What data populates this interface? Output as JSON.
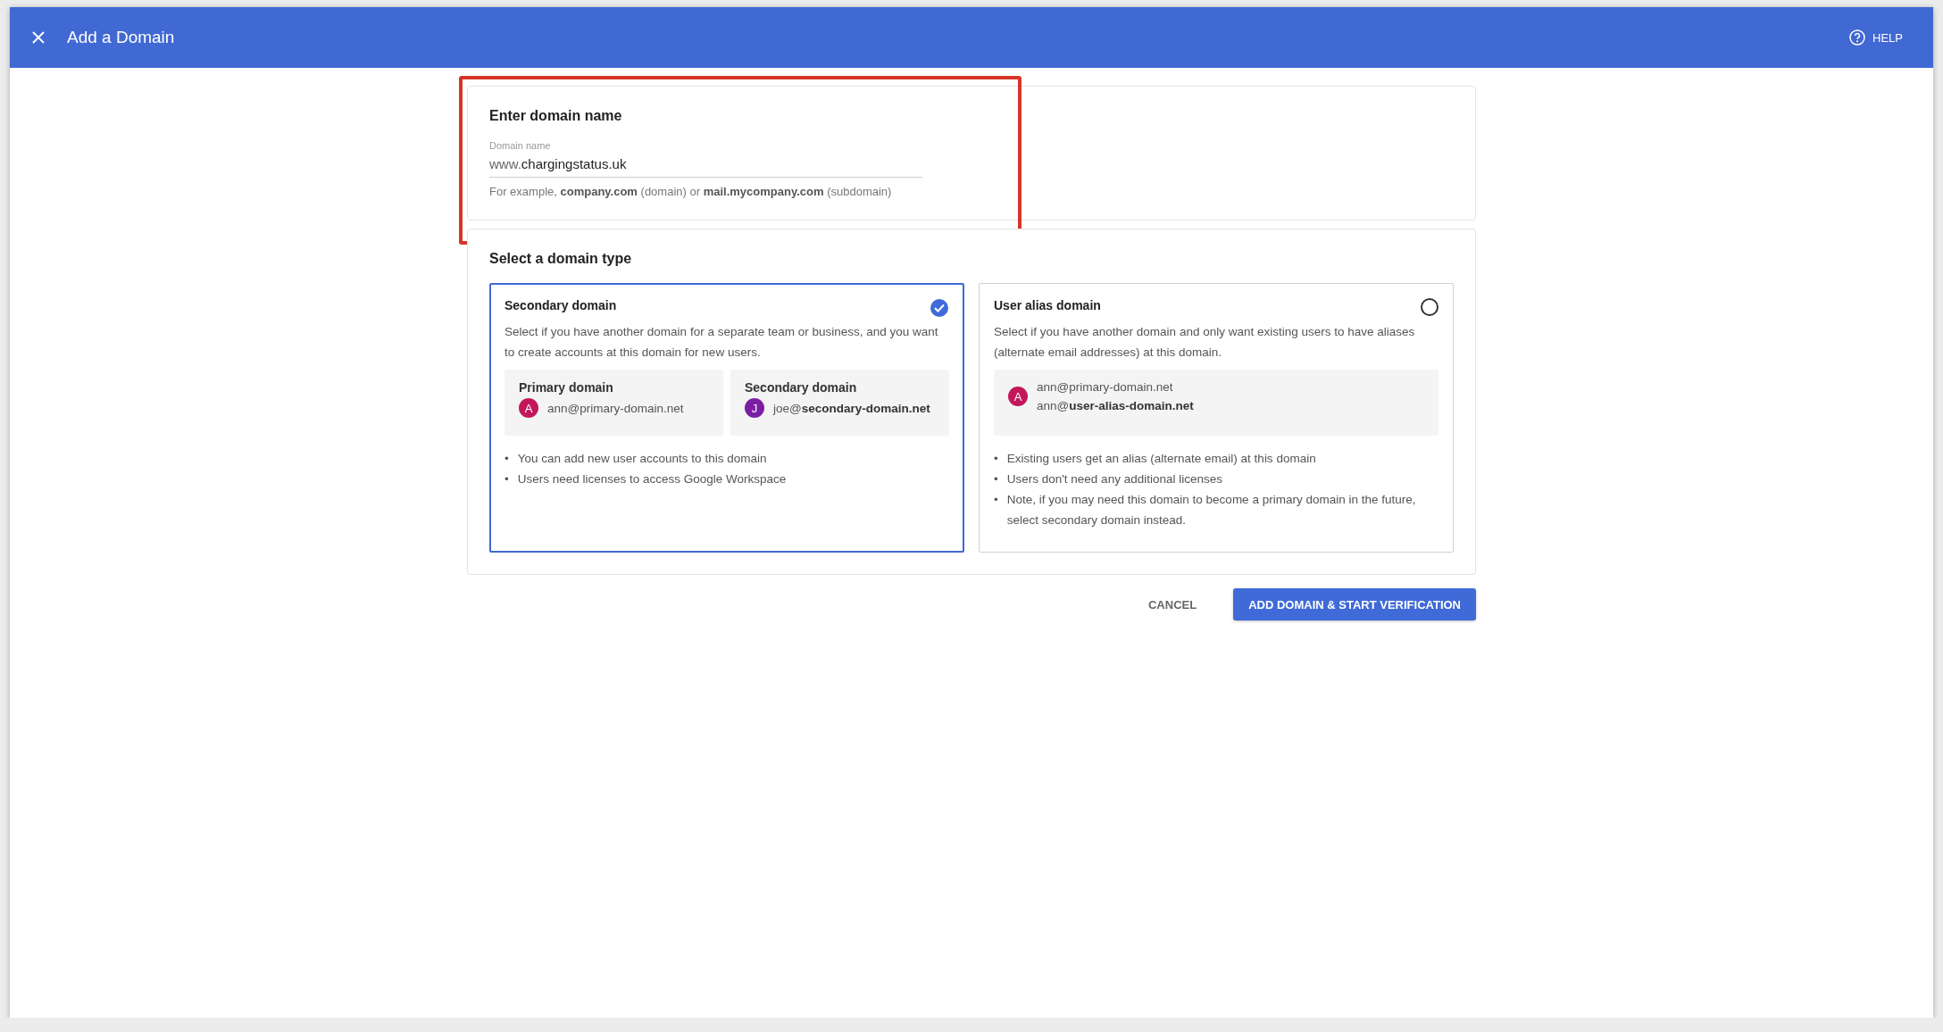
{
  "header": {
    "title": "Add a Domain",
    "help": "HELP"
  },
  "domain_card": {
    "highlighted": true,
    "title": "Enter domain name",
    "field": {
      "label": "Domain name",
      "prefix": "www.",
      "value": "chargingstatus.uk"
    },
    "hint": "For example, **company.com** (domain) or **mail.mycompany.com** (subdomain)"
  },
  "type_card": {
    "title": "Select a domain type",
    "options": [
      {
        "selected": true,
        "marker": "•",
        "title": "Secondary domain",
        "description": "Select if you have another domain for a separate team or business, and you want to create accounts at this domain for new users.",
        "examples": [
          {
            "label": "Primary domain",
            "avatar": "A",
            "color": "#c2185b",
            "emails": [
              "ann@primary-domain.net"
            ]
          },
          {
            "label": "Secondary domain",
            "avatar": "J",
            "color": "#7b1fa2",
            "emails": [
              "joe@**secondary-domain.net**"
            ]
          }
        ],
        "bullets": [
          "You can add new user accounts to this domain",
          "Users need licenses to access Google Workspace"
        ]
      },
      {
        "selected": false,
        "marker": "•",
        "title": "User alias domain",
        "description": "Select if you have another domain and only want existing users to have aliases (alternate email addresses) at this domain.",
        "examples": [
          {
            "avatar": "A",
            "color": "#c2185b",
            "emails": [
              "ann@primary-domain.net",
              "ann@**user-alias-domain.net**"
            ]
          }
        ],
        "bullets": [
          "Existing users get an alias (alternate email) at this domain",
          "Users don't need any additional licenses",
          "Note, if you may need this domain to become a primary domain in the future, select secondary domain instead."
        ]
      }
    ]
  },
  "actions": [
    {
      "kind": "text",
      "label": "CANCEL"
    },
    {
      "kind": "primary",
      "label": "ADD DOMAIN & START VERIFICATION"
    }
  ]
}
